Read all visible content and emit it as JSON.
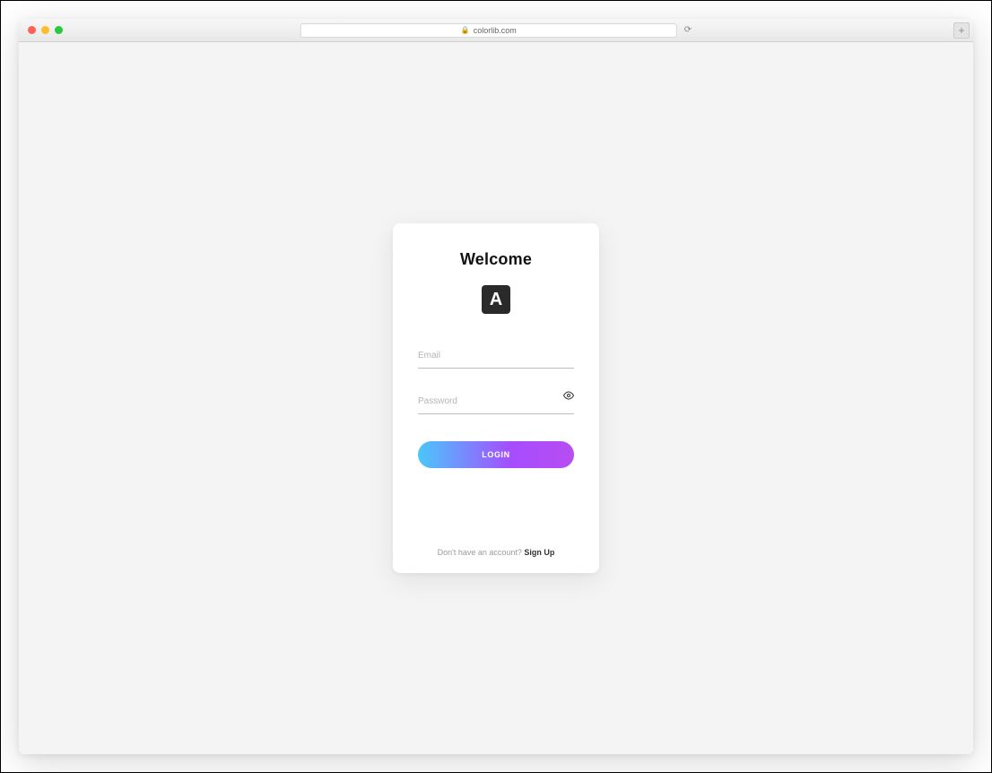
{
  "browser": {
    "url_host": "colorlib.com",
    "lock_glyph": "🔒",
    "reload_glyph": "⟳",
    "new_tab_glyph": "+"
  },
  "login": {
    "title": "Welcome",
    "logo_letter": "A",
    "email_placeholder": "Email",
    "password_placeholder": "Password",
    "eye_glyph": "👁",
    "login_button_label": "LOGIN",
    "signup_prompt": "Don't have an account? ",
    "signup_link_label": "Sign Up"
  }
}
